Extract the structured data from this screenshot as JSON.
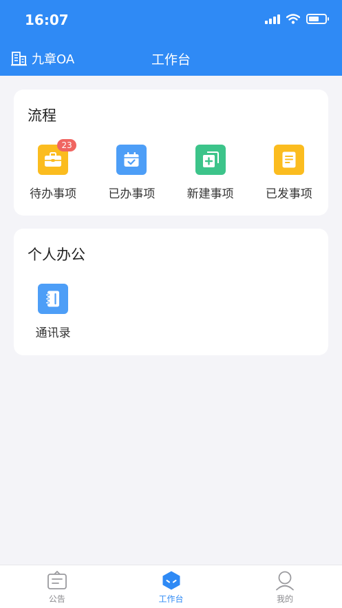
{
  "status_bar": {
    "time": "16:07"
  },
  "header": {
    "brand": "九章OA",
    "title": "工作台"
  },
  "flow_card": {
    "title": "流程",
    "items": [
      {
        "label": "待办事项",
        "badge": "23",
        "icon": "briefcase-icon",
        "color": "#fbbc1f"
      },
      {
        "label": "已办事项",
        "icon": "calendar-check-icon",
        "color": "#4d9ef7"
      },
      {
        "label": "新建事项",
        "icon": "new-document-icon",
        "color": "#3cc48a"
      },
      {
        "label": "已发事项",
        "icon": "document-icon",
        "color": "#fbbc1f"
      }
    ]
  },
  "office_card": {
    "title": "个人办公",
    "items": [
      {
        "label": "通讯录",
        "icon": "contact-book-icon",
        "color": "#4d9ef7"
      }
    ]
  },
  "tabbar": {
    "active": "工作台",
    "tabs": [
      {
        "label": "公告",
        "icon": "notice-icon"
      },
      {
        "label": "工作台",
        "icon": "workbench-icon"
      },
      {
        "label": "我的",
        "icon": "profile-icon"
      }
    ]
  },
  "colors": {
    "primary": "#2f8af5",
    "badge": "#f06561",
    "background": "#f4f4f8"
  }
}
